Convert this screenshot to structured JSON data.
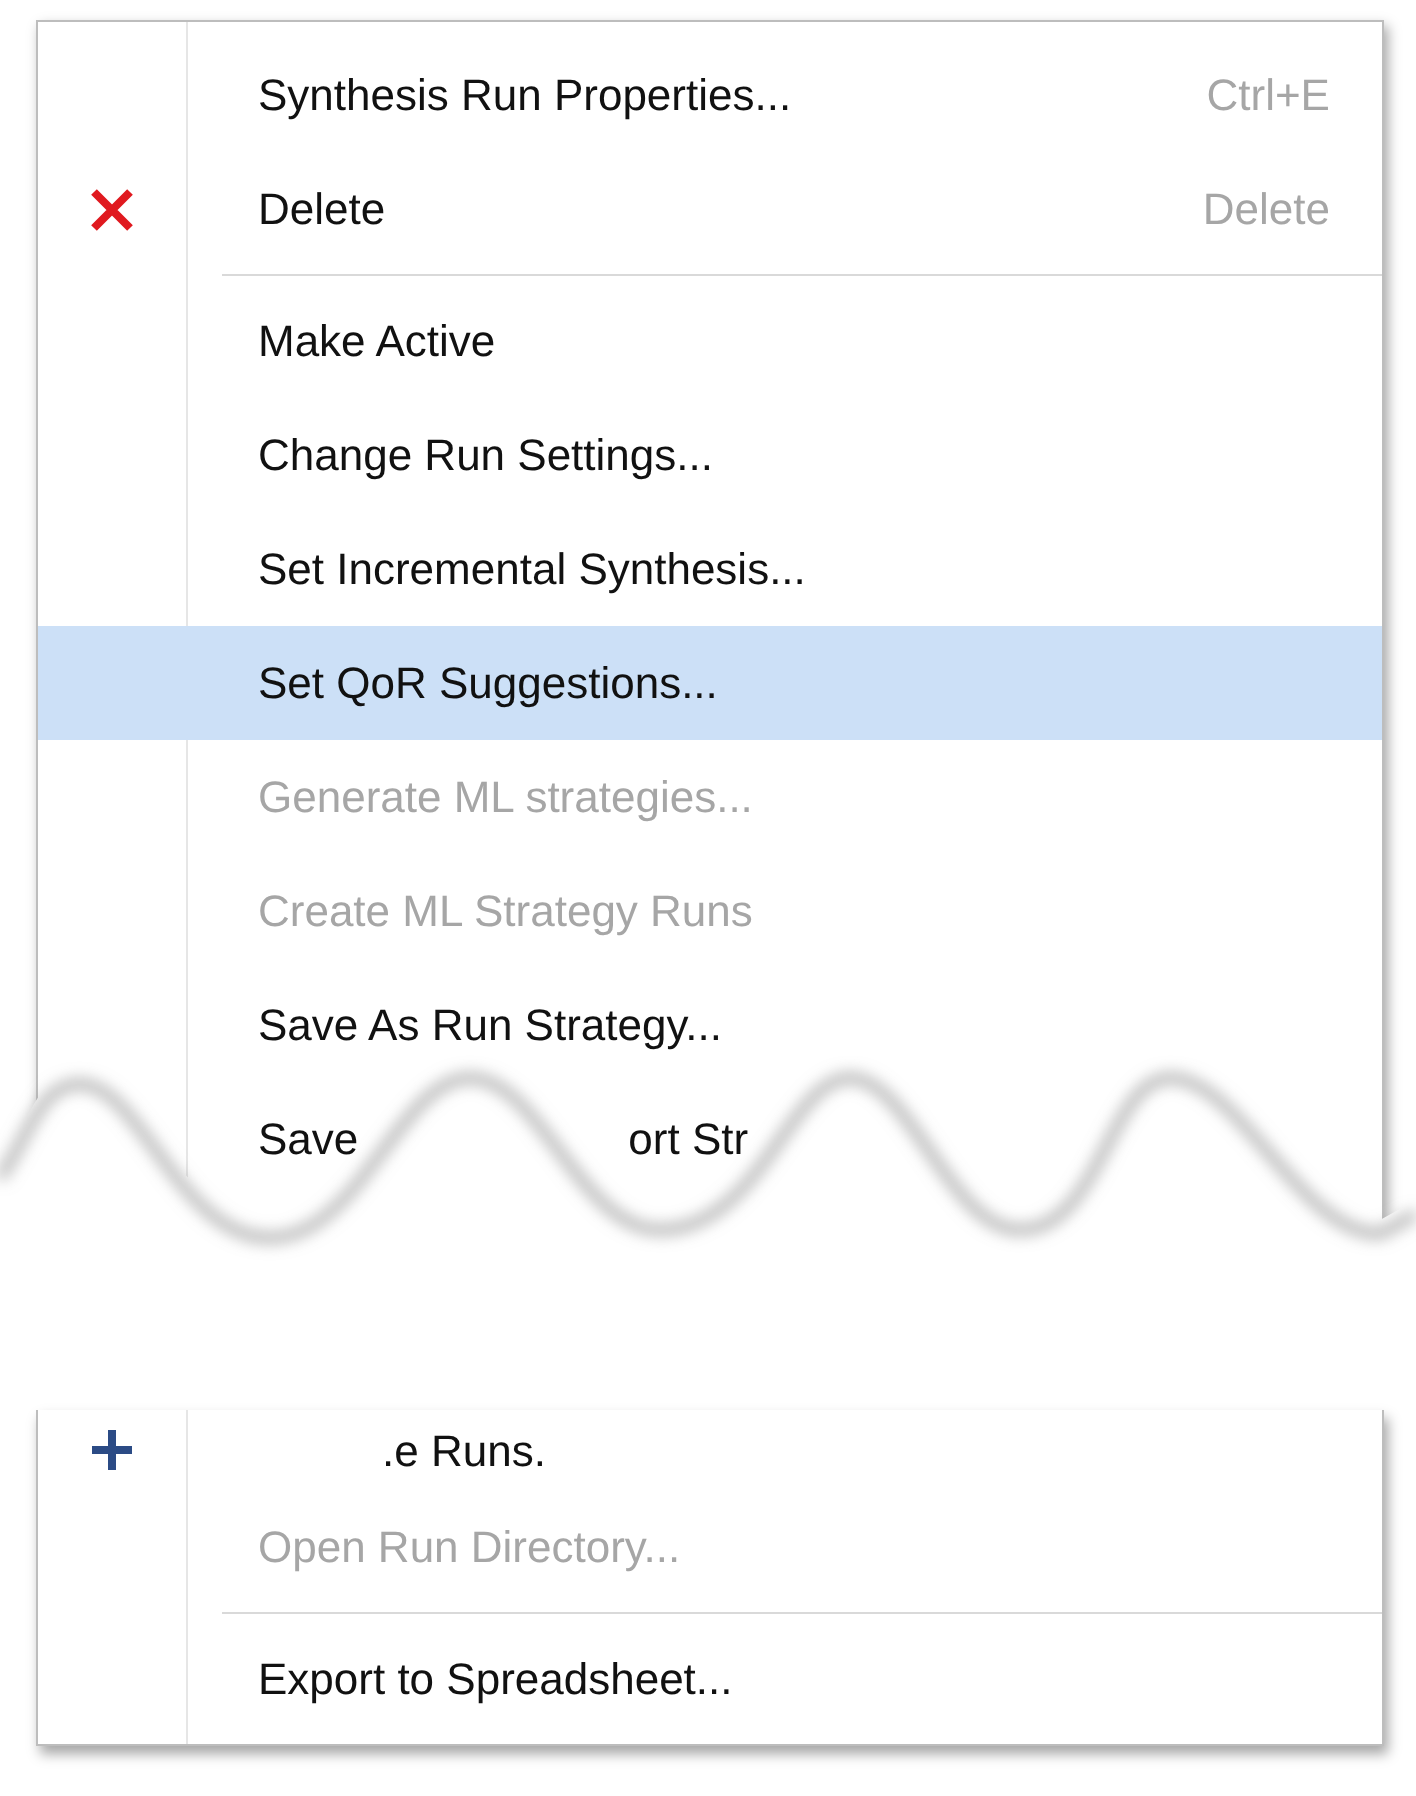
{
  "menu_upper": {
    "items": [
      {
        "kind": "item",
        "label": "Synthesis Run Properties...",
        "shortcut": "Ctrl+E",
        "disabled": false,
        "selected": false
      },
      {
        "kind": "delete-item",
        "label": "Delete",
        "shortcut": "Delete",
        "disabled": false,
        "selected": false
      },
      {
        "kind": "separator"
      },
      {
        "kind": "item",
        "label": "Make Active",
        "disabled": false,
        "selected": false
      },
      {
        "kind": "item",
        "label": "Change Run Settings...",
        "disabled": false,
        "selected": false
      },
      {
        "kind": "item",
        "label": "Set Incremental Synthesis...",
        "disabled": false,
        "selected": false
      },
      {
        "kind": "item",
        "label": "Set QoR Suggestions...",
        "disabled": false,
        "selected": true
      },
      {
        "kind": "item",
        "label": "Generate ML strategies...",
        "disabled": true,
        "selected": false
      },
      {
        "kind": "item",
        "label": "Create ML Strategy Runs",
        "disabled": true,
        "selected": false
      },
      {
        "kind": "item",
        "label": "Save As Run Strategy...",
        "disabled": false,
        "selected": false
      },
      {
        "kind": "torn",
        "fragments": [
          "Save",
          "ort Str"
        ],
        "disabled": false,
        "selected": false
      }
    ]
  },
  "menu_lower": {
    "items": [
      {
        "kind": "torn-add-item",
        "fragments": [
          ".e Runs."
        ],
        "disabled": false,
        "selected": false
      },
      {
        "kind": "item",
        "label": "Open Run Directory...",
        "disabled": true,
        "selected": false
      },
      {
        "kind": "separator"
      },
      {
        "kind": "item",
        "label": "Export to Spreadsheet...",
        "disabled": false,
        "selected": false
      }
    ]
  }
}
